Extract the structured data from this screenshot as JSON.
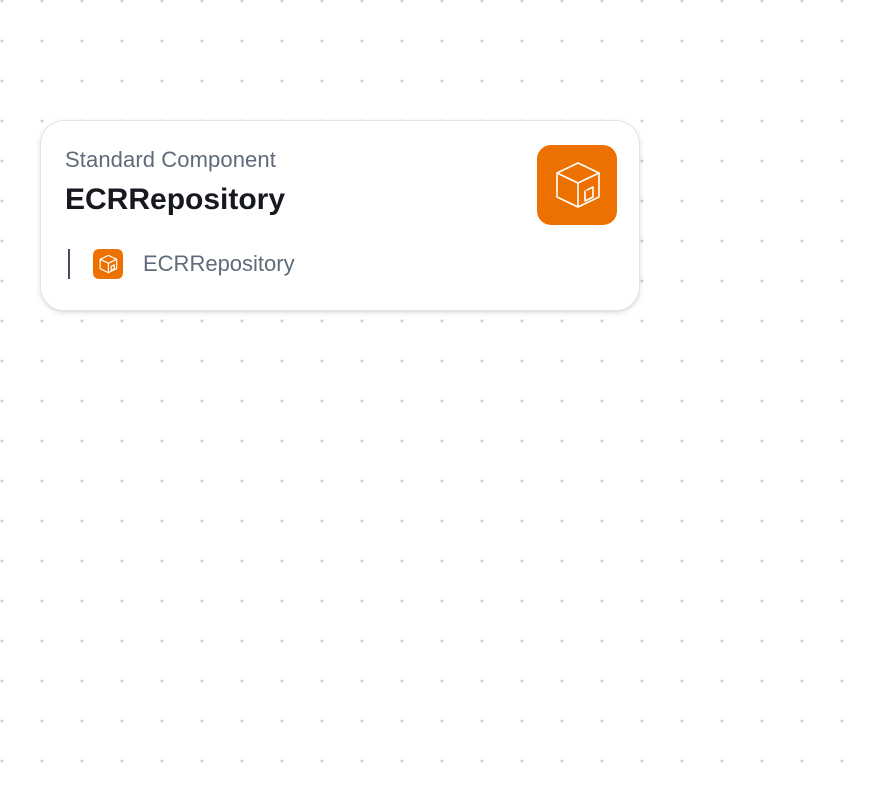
{
  "node": {
    "type_label": "Standard Component",
    "title": "ECRRepository",
    "icon": "ecr-repository-icon",
    "children": [
      {
        "label": "ECRRepository",
        "icon": "ecr-repository-icon"
      }
    ]
  },
  "colors": {
    "accent": "#ed7100",
    "canvas_dots": "#c9ccd1",
    "title_text": "#16191f",
    "secondary_text": "#5f6b7a"
  }
}
